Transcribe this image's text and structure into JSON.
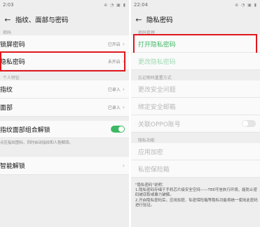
{
  "left": {
    "status_time": "2:03",
    "status_icons": "⊕ ◔ ▣ ▮",
    "title": "指纹、面部与密码",
    "section_password": "密码",
    "rows_password": [
      {
        "label": "锁屏密码",
        "value": "已开启"
      },
      {
        "label": "隐私密码",
        "value": "未开启"
      }
    ],
    "section_personal": "个人特征",
    "rows_personal": [
      {
        "label": "指纹",
        "value": "已录入"
      },
      {
        "label": "面部",
        "value": "已录入"
      }
    ],
    "combo_label": "指纹面部组合解锁",
    "combo_desc": "点压指纹图标，同时启动指纹和人脸解锁。",
    "smart_unlock": "智能解锁",
    "accent": "#3cb864",
    "highlight": "#e0161c"
  },
  "right": {
    "status_time": "22:04",
    "status_icons": "⊕ ◔ ▣ ▮",
    "title": "隐私密码",
    "section_manage": "密码管理",
    "open_password": "打开隐私密码",
    "change_password": "更改隐私密码",
    "section_reset": "忘记密码重置方式",
    "reset_items": [
      "更改安全问题",
      "绑定安全邮箱",
      "关联OPPO账号"
    ],
    "section_features": "隐私功能",
    "feature_items": [
      "应用加密",
      "私密保险箱"
    ],
    "note": "\"隐私密码\"说明：\n1.隐私密码存储于手机芯片级安全空间——TEE可信执行环境，能防止密码被窃取或暴力破解。\n2.开启隐私密码后，应用加密、私密保险箱等隐私功能将统一使用此密码进行验证。"
  }
}
